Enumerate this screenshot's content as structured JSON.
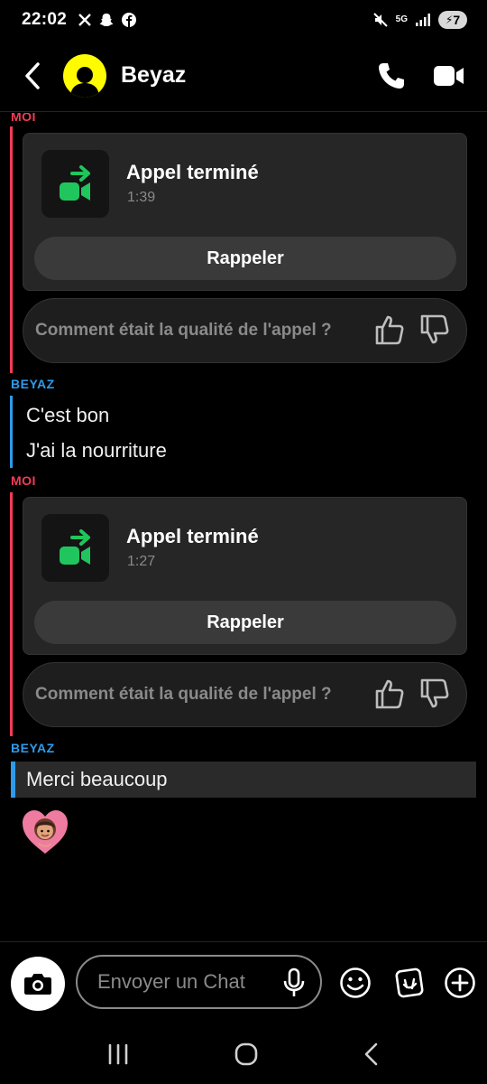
{
  "status_bar": {
    "time": "22:02",
    "left_icons": [
      "x-icon",
      "snapchat-icon",
      "facebook-icon"
    ],
    "network": "5G",
    "battery": "7"
  },
  "header": {
    "contact_name": "Beyaz"
  },
  "messages": {
    "sender_moi": "MOI",
    "sender_beyaz": "BEYAZ",
    "call1": {
      "title": "Appel terminé",
      "duration": "1:39",
      "recall": "Rappeler"
    },
    "feedback1": "Comment était la qualité de l'appel ?",
    "text1": "C'est bon",
    "text2": "J'ai la nourriture",
    "call2": {
      "title": "Appel terminé",
      "duration": "1:27",
      "recall": "Rappeler"
    },
    "feedback2": "Comment était la qualité de l'appel ?",
    "text3": "Merci beaucoup",
    "reaction": "heart-avatar-reaction"
  },
  "composer": {
    "placeholder": "Envoyer un Chat"
  },
  "colors": {
    "moi": "#f23c57",
    "beyaz": "#2e9bea",
    "snap_yellow": "#fffc00",
    "call_green": "#21c55d"
  }
}
